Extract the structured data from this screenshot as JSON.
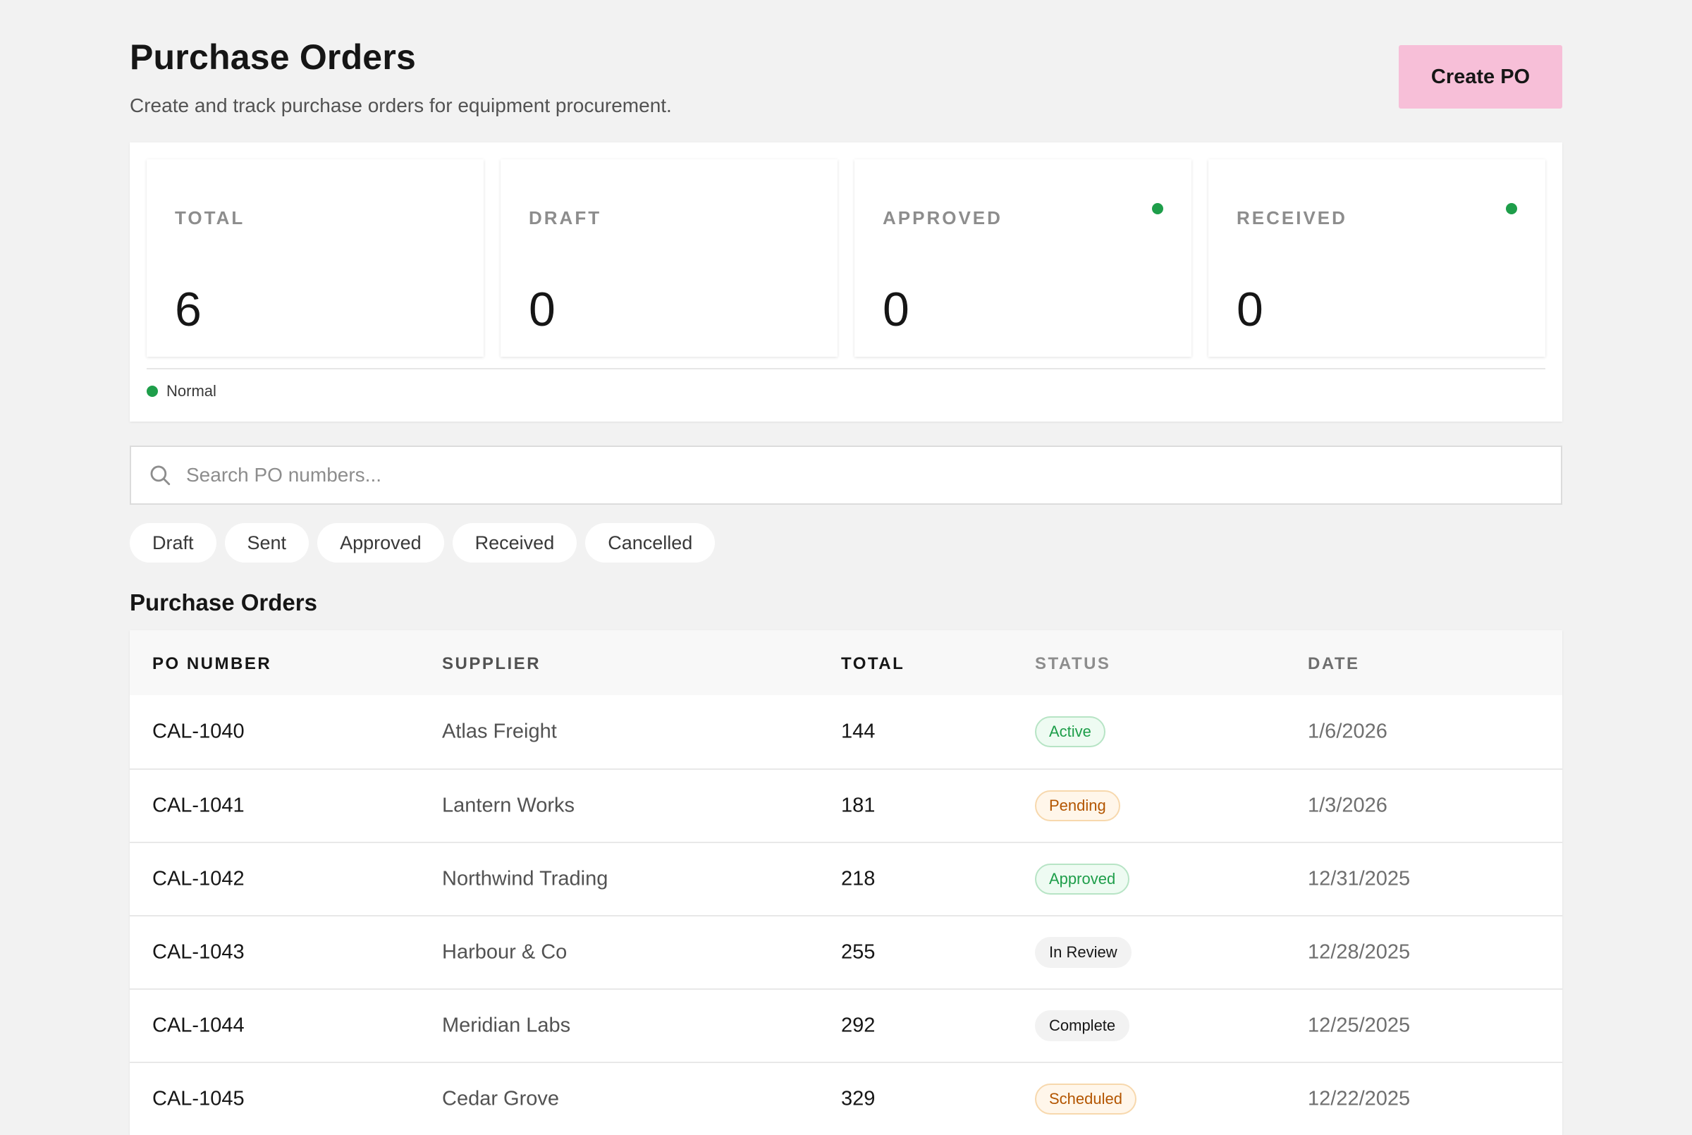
{
  "header": {
    "title": "Purchase Orders",
    "subtitle": "Create and track purchase orders for equipment procurement.",
    "create_button": "Create PO"
  },
  "stats": [
    {
      "label": "TOTAL",
      "value": "6",
      "has_dot": false
    },
    {
      "label": "DRAFT",
      "value": "0",
      "has_dot": false
    },
    {
      "label": "APPROVED",
      "value": "0",
      "has_dot": true
    },
    {
      "label": "RECEIVED",
      "value": "0",
      "has_dot": true
    }
  ],
  "legend": {
    "label": "Normal",
    "color": "#1e9e4a"
  },
  "search": {
    "placeholder": "Search PO numbers...",
    "value": ""
  },
  "filters": [
    "Draft",
    "Sent",
    "Approved",
    "Received",
    "Cancelled"
  ],
  "table": {
    "title": "Purchase Orders",
    "columns": [
      "PO NUMBER",
      "SUPPLIER",
      "TOTAL",
      "STATUS",
      "DATE"
    ],
    "rows": [
      {
        "po": "CAL-1040",
        "supplier": "Atlas Freight",
        "total": "144",
        "status": "Active",
        "status_tone": "green",
        "date": "1/6/2026"
      },
      {
        "po": "CAL-1041",
        "supplier": "Lantern Works",
        "total": "181",
        "status": "Pending",
        "status_tone": "orange",
        "date": "1/3/2026"
      },
      {
        "po": "CAL-1042",
        "supplier": "Northwind Trading",
        "total": "218",
        "status": "Approved",
        "status_tone": "green",
        "date": "12/31/2025"
      },
      {
        "po": "CAL-1043",
        "supplier": "Harbour & Co",
        "total": "255",
        "status": "In Review",
        "status_tone": "gray",
        "date": "12/28/2025"
      },
      {
        "po": "CAL-1044",
        "supplier": "Meridian Labs",
        "total": "292",
        "status": "Complete",
        "status_tone": "gray",
        "date": "12/25/2025"
      },
      {
        "po": "CAL-1045",
        "supplier": "Cedar Grove",
        "total": "329",
        "status": "Scheduled",
        "status_tone": "orange",
        "date": "12/22/2025"
      }
    ]
  },
  "colors": {
    "accent": "#f7bfd8",
    "success": "#1e9e4a",
    "warning": "#b35500"
  }
}
